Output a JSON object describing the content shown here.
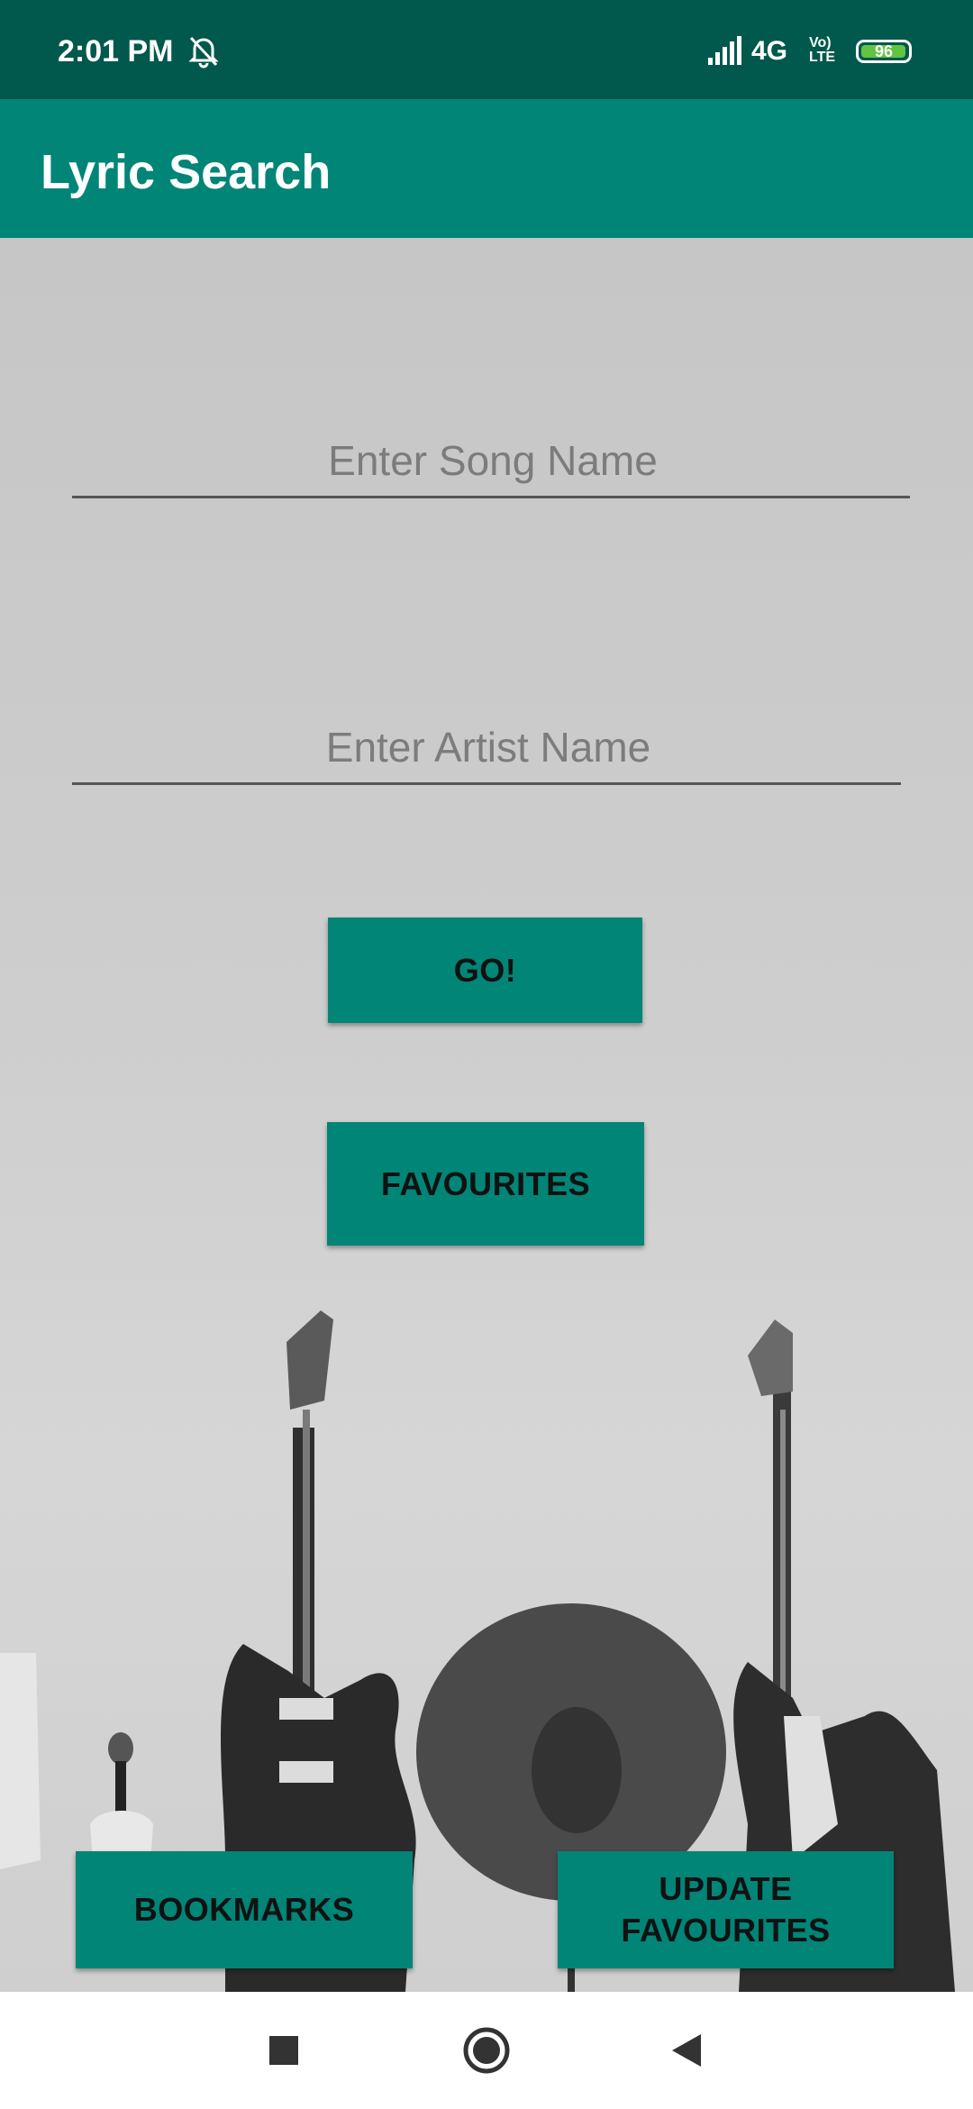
{
  "status_bar": {
    "time": "2:01 PM",
    "network": "4G",
    "volte": "Vo) LTE",
    "battery": "96",
    "icons": [
      "alarm-off-icon",
      "signal-icon",
      "battery-icon"
    ],
    "battery_color": "#61c442"
  },
  "app_bar": {
    "title": "Lyric Search",
    "color": "#008577"
  },
  "form": {
    "song_placeholder": "Enter Song Name",
    "artist_placeholder": "Enter Artist Name"
  },
  "buttons": {
    "go": "GO!",
    "favourites": "FAVOURITES",
    "bookmarks": "BOOKMARKS",
    "update_line1": "UPDATE",
    "update_line2": "FAVOURITES"
  },
  "nav": {
    "icons": [
      "recent-apps-icon",
      "home-icon",
      "back-icon"
    ]
  }
}
